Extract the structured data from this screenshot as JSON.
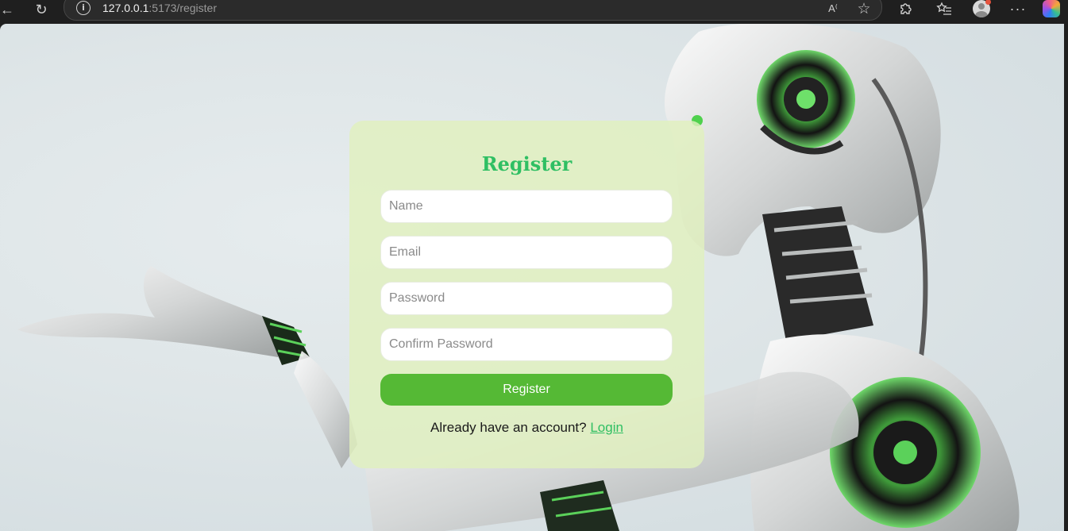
{
  "browser": {
    "back_icon": "back-arrow-icon",
    "reload_icon": "reload-icon",
    "info_icon": "info-icon",
    "url_host": "127.0.0.1",
    "url_path": ":5173/register",
    "read_aloud_icon": "read-aloud-icon",
    "favorite_icon": "star-icon",
    "extensions_icon": "puzzle-icon",
    "favorites_icon": "favorites-list-icon",
    "menu_icon": "more-icon",
    "copilot_icon": "copilot-icon"
  },
  "register": {
    "title": "Register",
    "name_placeholder": "Name",
    "email_placeholder": "Email",
    "password_placeholder": "Password",
    "confirm_password_placeholder": "Confirm Password",
    "submit_label": "Register",
    "login_prompt": "Already have an account? ",
    "login_link": "Login"
  },
  "colors": {
    "accent_green": "#2fbf63",
    "button_green": "#55b935",
    "card_background": "#e1f0be"
  }
}
